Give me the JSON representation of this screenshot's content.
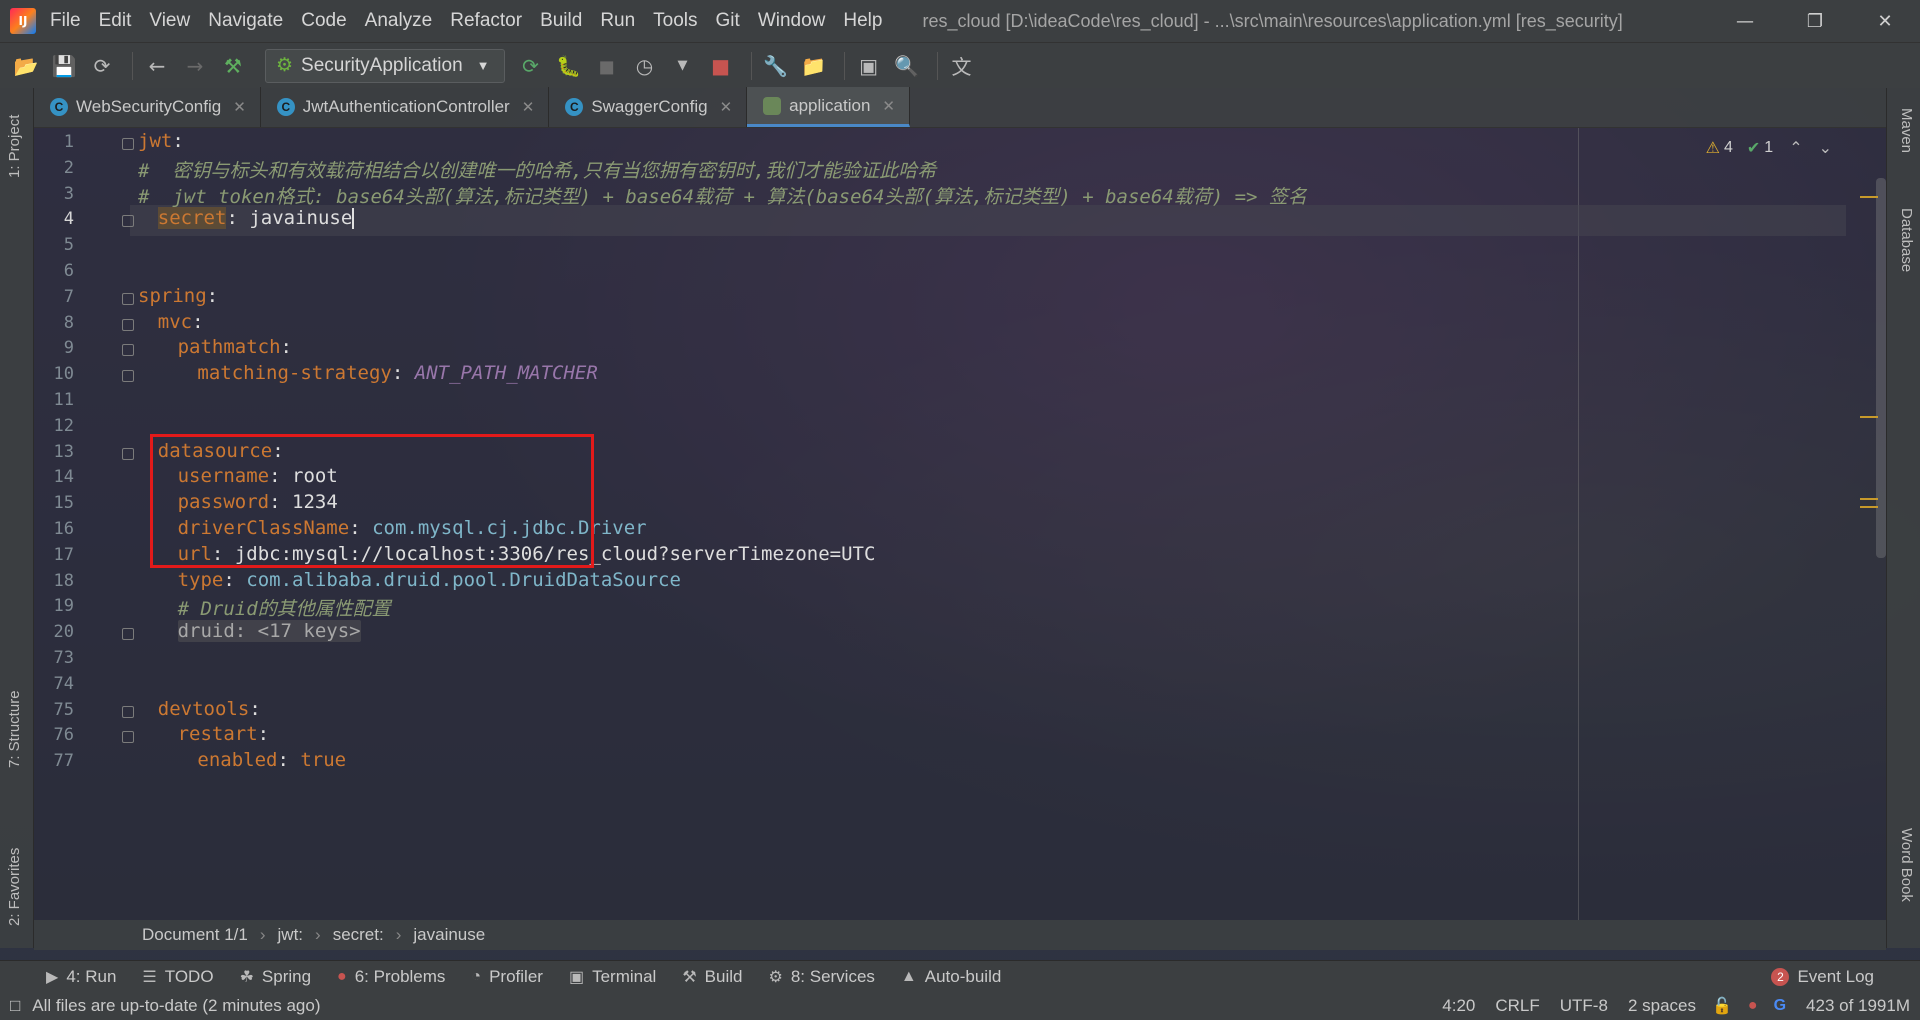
{
  "app": {
    "title": "res_cloud [D:\\ideaCode\\res_cloud] - ...\\src\\main\\resources\\application.yml [res_security]",
    "logo_text": "IJ"
  },
  "menu": [
    "File",
    "Edit",
    "View",
    "Navigate",
    "Code",
    "Analyze",
    "Refactor",
    "Build",
    "Run",
    "Tools",
    "Git",
    "Window",
    "Help"
  ],
  "toolbar": {
    "run_config": "SecurityApplication"
  },
  "tabs": [
    {
      "label": "WebSecurityConfig",
      "type": "class",
      "active": false
    },
    {
      "label": "JwtAuthenticationController",
      "type": "class",
      "active": false
    },
    {
      "label": "SwaggerConfig",
      "type": "class",
      "active": false
    },
    {
      "label": "application",
      "type": "yaml",
      "active": true
    }
  ],
  "left_tools": [
    "1: Project",
    "7: Structure",
    "2: Favorites"
  ],
  "right_tools": [
    "Maven",
    "Database",
    "Word Book"
  ],
  "inspection": {
    "warnings": "4",
    "ok": "1"
  },
  "editor": {
    "lines": [
      {
        "num": "1",
        "indent": 0,
        "key": "jwt",
        "sep": ":",
        "value": "",
        "vtype": "none",
        "comment": "",
        "fold": true
      },
      {
        "num": "2",
        "indent": 0,
        "key": "",
        "sep": "",
        "value": "",
        "vtype": "none",
        "comment": "#  密钥与标头和有效载荷相结合以创建唯一的哈希,只有当您拥有密钥时,我们才能验证此哈希",
        "fold": false
      },
      {
        "num": "3",
        "indent": 0,
        "key": "",
        "sep": "",
        "value": "",
        "vtype": "none",
        "comment": "#  jwt token格式: base64头部(算法,标记类型) + base64载荷 + 算法(base64头部(算法,标记类型) + base64载荷) => 签名",
        "fold": false
      },
      {
        "num": "4",
        "indent": 1,
        "key": "secret",
        "sep": ": ",
        "value": "javainuse",
        "vtype": "plain",
        "comment": "",
        "fold": true,
        "current": true
      },
      {
        "num": "5",
        "indent": 0,
        "key": "",
        "sep": "",
        "value": "",
        "vtype": "none",
        "comment": "",
        "fold": false
      },
      {
        "num": "6",
        "indent": 0,
        "key": "",
        "sep": "",
        "value": "",
        "vtype": "none",
        "comment": "",
        "fold": false
      },
      {
        "num": "7",
        "indent": 0,
        "key": "spring",
        "sep": ":",
        "value": "",
        "vtype": "none",
        "comment": "",
        "fold": true
      },
      {
        "num": "8",
        "indent": 1,
        "key": "mvc",
        "sep": ":",
        "value": "",
        "vtype": "none",
        "comment": "",
        "fold": true
      },
      {
        "num": "9",
        "indent": 2,
        "key": "pathmatch",
        "sep": ":",
        "value": "",
        "vtype": "none",
        "comment": "",
        "fold": true
      },
      {
        "num": "10",
        "indent": 3,
        "key": "matching-strategy",
        "sep": ": ",
        "value": "ANT_PATH_MATCHER",
        "vtype": "const",
        "comment": "",
        "fold": true
      },
      {
        "num": "11",
        "indent": 0,
        "key": "",
        "sep": "",
        "value": "",
        "vtype": "none",
        "comment": "",
        "fold": false
      },
      {
        "num": "12",
        "indent": 0,
        "key": "",
        "sep": "",
        "value": "",
        "vtype": "none",
        "comment": "",
        "fold": false
      },
      {
        "num": "13",
        "indent": 1,
        "key": "datasource",
        "sep": ":",
        "value": "",
        "vtype": "none",
        "comment": "",
        "fold": true
      },
      {
        "num": "14",
        "indent": 2,
        "key": "username",
        "sep": ": ",
        "value": "root",
        "vtype": "plain",
        "comment": "",
        "fold": false
      },
      {
        "num": "15",
        "indent": 2,
        "key": "password",
        "sep": ": ",
        "value": "1234",
        "vtype": "plain",
        "comment": "",
        "fold": false
      },
      {
        "num": "16",
        "indent": 2,
        "key": "driverClassName",
        "sep": ": ",
        "value": "com.mysql.cj.jdbc.Driver",
        "vtype": "class",
        "comment": "",
        "fold": false
      },
      {
        "num": "17",
        "indent": 2,
        "key": "url",
        "sep": ": ",
        "value": "jdbc:mysql://localhost:3306/res_cloud?serverTimezone=UTC",
        "vtype": "plain",
        "comment": "",
        "fold": false
      },
      {
        "num": "18",
        "indent": 2,
        "key": "type",
        "sep": ": ",
        "value": "com.alibaba.druid.pool.DruidDataSource",
        "vtype": "class",
        "comment": "",
        "fold": false
      },
      {
        "num": "19",
        "indent": 2,
        "key": "",
        "sep": "",
        "value": "",
        "vtype": "none",
        "comment": "# Druid的其他属性配置",
        "fold": false
      },
      {
        "num": "20",
        "indent": 2,
        "key": "",
        "sep": "",
        "value": "druid: <17 keys>",
        "vtype": "folded",
        "comment": "",
        "fold": true
      },
      {
        "num": "73",
        "indent": 0,
        "key": "",
        "sep": "",
        "value": "",
        "vtype": "none",
        "comment": "",
        "fold": false
      },
      {
        "num": "74",
        "indent": 0,
        "key": "",
        "sep": "",
        "value": "",
        "vtype": "none",
        "comment": "",
        "fold": false
      },
      {
        "num": "75",
        "indent": 1,
        "key": "devtools",
        "sep": ":",
        "value": "",
        "vtype": "none",
        "comment": "",
        "fold": true
      },
      {
        "num": "76",
        "indent": 2,
        "key": "restart",
        "sep": ":",
        "value": "",
        "vtype": "none",
        "comment": "",
        "fold": true
      },
      {
        "num": "77",
        "indent": 3,
        "key": "enabled",
        "sep": ": ",
        "value": "true",
        "vtype": "bool",
        "comment": "",
        "fold": false
      }
    ]
  },
  "breadcrumb": [
    "Document 1/1",
    "jwt:",
    "secret:",
    "javainuse"
  ],
  "toolwindows": [
    {
      "label": "4: Run",
      "icon": "run-icon"
    },
    {
      "label": "TODO",
      "icon": "todo-icon"
    },
    {
      "label": "Spring",
      "icon": "spring-icon"
    },
    {
      "label": "6: Problems",
      "icon": "problems-icon"
    },
    {
      "label": "Profiler",
      "icon": "profiler-icon"
    },
    {
      "label": "Terminal",
      "icon": "terminal-icon"
    },
    {
      "label": "Build",
      "icon": "build-icon"
    },
    {
      "label": "8: Services",
      "icon": "services-icon"
    },
    {
      "label": "Auto-build",
      "icon": "auto-build-icon"
    }
  ],
  "event_log": {
    "label": "Event Log",
    "count": "2"
  },
  "status": {
    "message": "All files are up-to-date (2 minutes ago)",
    "position": "4:20",
    "line_sep": "CRLF",
    "encoding": "UTF-8",
    "indent": "2 spaces",
    "memory": "423 of 1991M"
  },
  "colors": {
    "highlight_box": "#e21a1a",
    "key": "#cc7832",
    "comment": "#8a9a73",
    "const": "#9876aa"
  }
}
